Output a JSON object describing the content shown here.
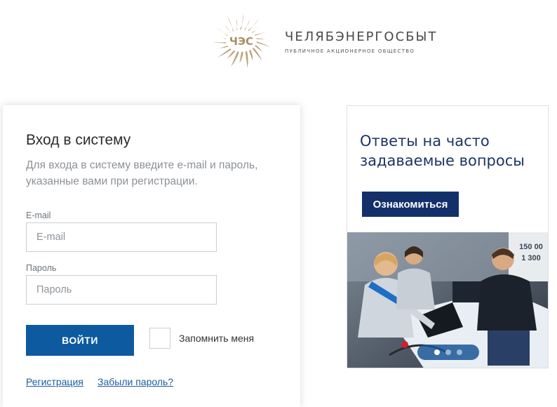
{
  "header": {
    "logo_abbr": "ЧЭС",
    "company_name": "ЧЕЛЯБЭНЕРГОСБЫТ",
    "company_subtitle": "ПУБЛИЧНОЕ АКЦИОНЕРНОЕ ОБЩЕСТВО",
    "logo_icon": "sun-logo-icon",
    "logo_color": "#b8a27e"
  },
  "login": {
    "title": "Вход в систему",
    "description": "Для входа в систему введите e-mail и пароль, указанные вами при регистрации.",
    "email_label": "E-mail",
    "email_placeholder": "E-mail",
    "email_value": "",
    "password_label": "Пароль",
    "password_placeholder": "Пароль",
    "password_value": "",
    "submit_label": "ВОЙТИ",
    "remember_label": "Запомнить меня",
    "remember_checked": false,
    "register_link": "Регистрация",
    "forgot_link": "Забыли пароль?",
    "accent_color": "#0d5aa0"
  },
  "promo": {
    "title": "Ответы на часто задаваемые вопросы",
    "button_label": "Ознакомиться",
    "photo_text_lines": [
      "150 00",
      "1 300"
    ],
    "slides_count": 3,
    "active_slide": 1,
    "brand_color": "#13306b"
  }
}
